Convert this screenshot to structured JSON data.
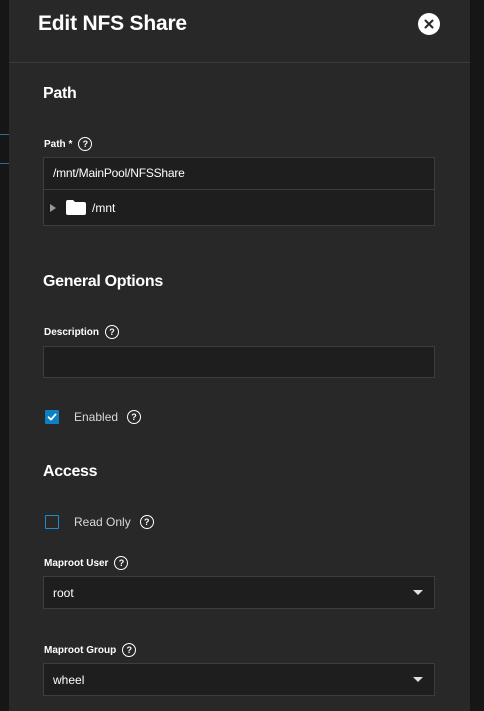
{
  "panel": {
    "title": "Edit NFS Share"
  },
  "path_section": {
    "title": "Path",
    "path_label": "Path *",
    "path_value": "/mnt/MainPool/NFSShare",
    "tree_root": "/mnt"
  },
  "general_section": {
    "title": "General Options",
    "description_label": "Description",
    "description_value": "",
    "enabled_label": "Enabled",
    "enabled_checked": true
  },
  "access_section": {
    "title": "Access",
    "read_only_label": "Read Only",
    "read_only_checked": false,
    "maproot_user_label": "Maproot User",
    "maproot_user_value": "root",
    "maproot_group_label": "Maproot Group",
    "maproot_group_value": "wheel"
  },
  "icons": {
    "close": "close-icon",
    "help": "help-icon",
    "folder": "folder-icon",
    "expand": "expand-arrow-icon",
    "dropdown": "chevron-down-icon"
  },
  "colors": {
    "panel_bg": "#282828",
    "input_bg": "#1e1e1e",
    "accent": "#0d7fc4",
    "text": "#ffffff"
  }
}
